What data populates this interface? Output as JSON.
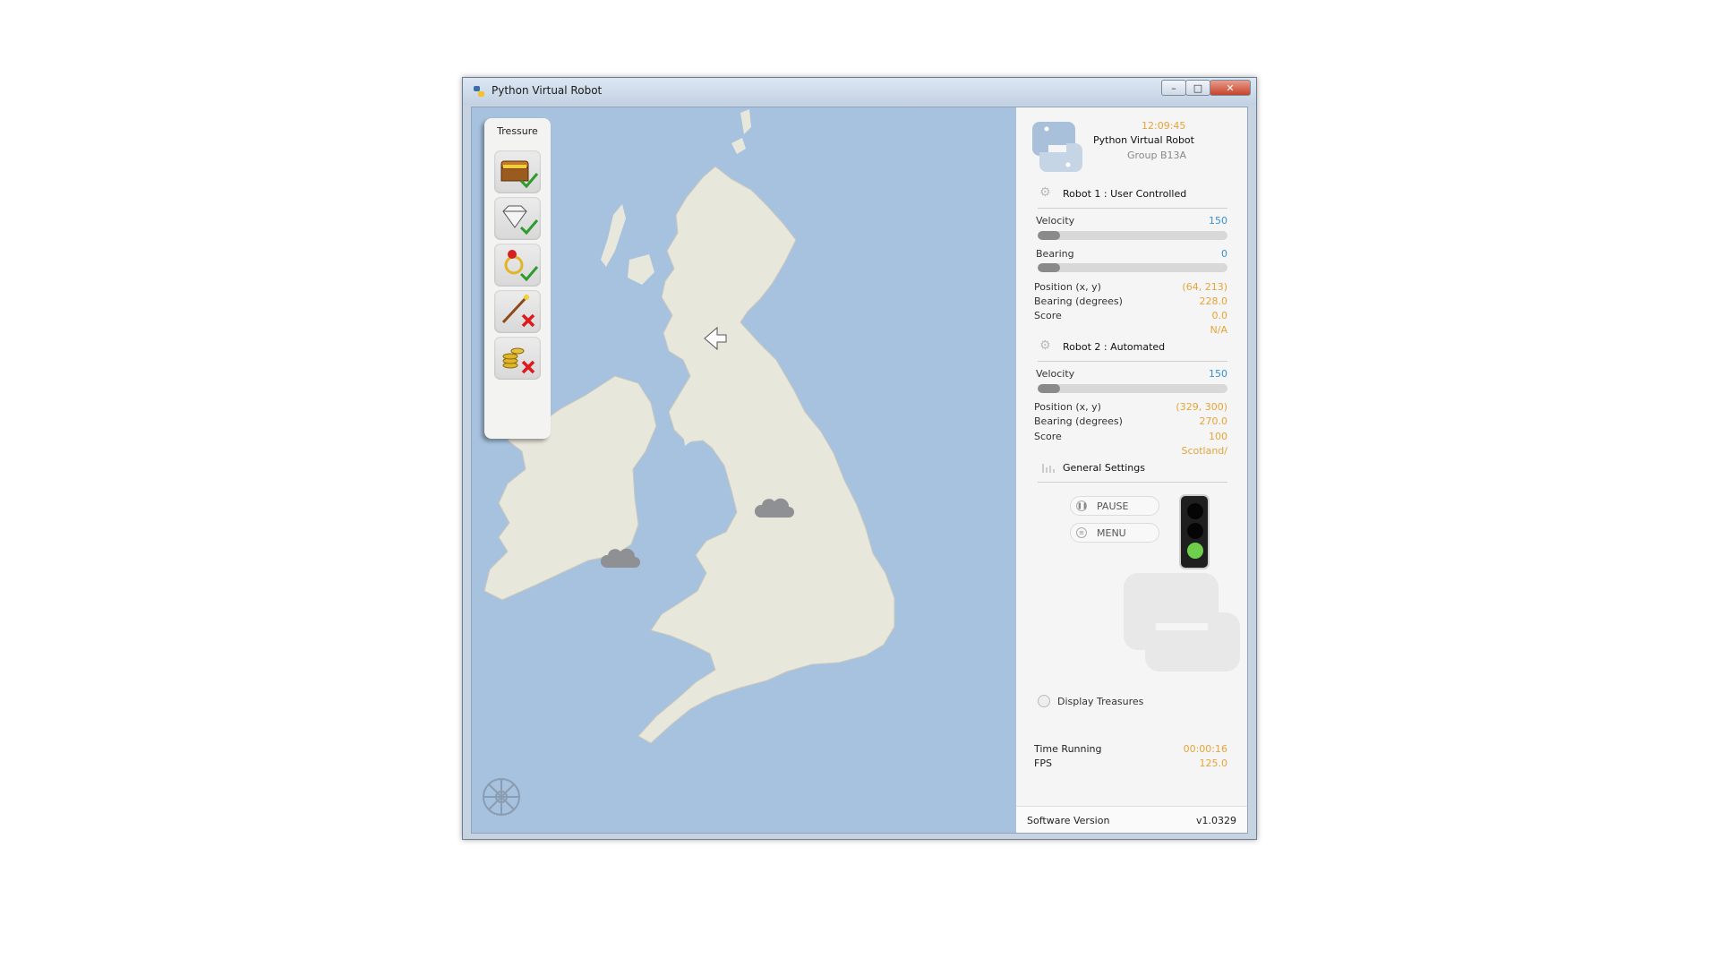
{
  "window": {
    "title": "Python Virtual Robot",
    "buttons": {
      "minimize": "–",
      "maximize": "□",
      "close": "✕"
    }
  },
  "treasure_panel": {
    "title": "Tressure",
    "items": [
      {
        "name": "treasure-chest",
        "icon": "chest-icon",
        "status": "found"
      },
      {
        "name": "diamond",
        "icon": "diamond-icon",
        "status": "found"
      },
      {
        "name": "ring",
        "icon": "ring-icon",
        "status": "found"
      },
      {
        "name": "sceptre",
        "icon": "wand-icon",
        "status": "missing"
      },
      {
        "name": "coins",
        "icon": "coins-icon",
        "status": "missing"
      }
    ]
  },
  "header": {
    "time": "12:09:45",
    "app_name": "Python Virtual Robot",
    "group": "Group B13A"
  },
  "robot1": {
    "title": "Robot 1 : User Controlled",
    "velocity_label": "Velocity",
    "velocity_value": "150",
    "velocity_fraction": 0.12,
    "bearing_label": "Bearing",
    "bearing_value": "0",
    "bearing_fraction": 0.12,
    "position_label": "Position (x, y)",
    "position_value": "(64, 213)",
    "bearing_deg_label": "Bearing (degrees)",
    "bearing_deg_value": "228.0",
    "score_label": "Score",
    "score_value": "0.0",
    "location": "N/A"
  },
  "robot2": {
    "title": "Robot 2 : Automated",
    "velocity_label": "Velocity",
    "velocity_value": "150",
    "velocity_fraction": 0.12,
    "position_label": "Position (x, y)",
    "position_value": "(329, 300)",
    "bearing_deg_label": "Bearing (degrees)",
    "bearing_deg_value": "270.0",
    "score_label": "Score",
    "score_value": "100",
    "location": "Scotland/"
  },
  "general": {
    "title": "General Settings",
    "pause_label": "PAUSE",
    "menu_label": "MENU",
    "traffic_light_state": "green",
    "display_treasures_label": "Display Treasures",
    "time_running_label": "Time Running",
    "time_running_value": "00:00:16",
    "fps_label": "FPS",
    "fps_value": "125.0",
    "software_version_label": "Software Version",
    "software_version_value": "v1.0329"
  },
  "colors": {
    "sea": "#a7c2de",
    "land": "#e8e7dc",
    "accent_orange": "#e5a43a",
    "accent_blue": "#3a8fd2",
    "traffic_green": "#6ecf4c"
  }
}
